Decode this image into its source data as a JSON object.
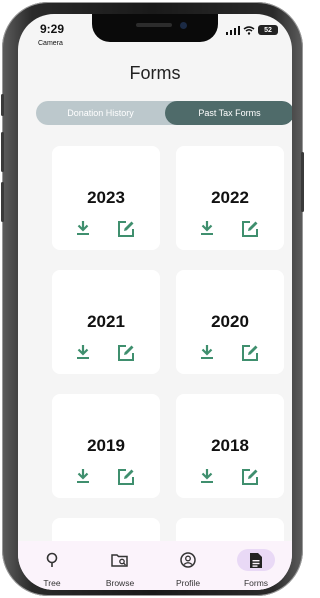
{
  "status_bar": {
    "time": "9:29",
    "carrier": "Camera",
    "battery": "52"
  },
  "header": {
    "title": "Forms"
  },
  "segments": [
    {
      "label": "Donation History",
      "active": false
    },
    {
      "label": "Past Tax Forms",
      "active": true
    }
  ],
  "forms": [
    {
      "year": "2023"
    },
    {
      "year": "2022"
    },
    {
      "year": "2021"
    },
    {
      "year": "2020"
    },
    {
      "year": "2019"
    },
    {
      "year": "2018"
    },
    {
      "year": ""
    },
    {
      "year": ""
    }
  ],
  "icons": {
    "download": "download-icon",
    "edit": "edit-icon"
  },
  "tabs": [
    {
      "label": "Tree",
      "icon": "tree-icon",
      "active": false
    },
    {
      "label": "Browse",
      "icon": "browse-icon",
      "active": false
    },
    {
      "label": "Profile",
      "icon": "profile-icon",
      "active": false
    },
    {
      "label": "Forms",
      "icon": "forms-icon",
      "active": true
    }
  ],
  "colors": {
    "accent": "#3f8f6e",
    "segment_active": "#4f6b6a",
    "segment_bg": "#bcc8cc",
    "tabbar_bg": "#fbf3fb",
    "active_tab": "#e9d9f6"
  }
}
